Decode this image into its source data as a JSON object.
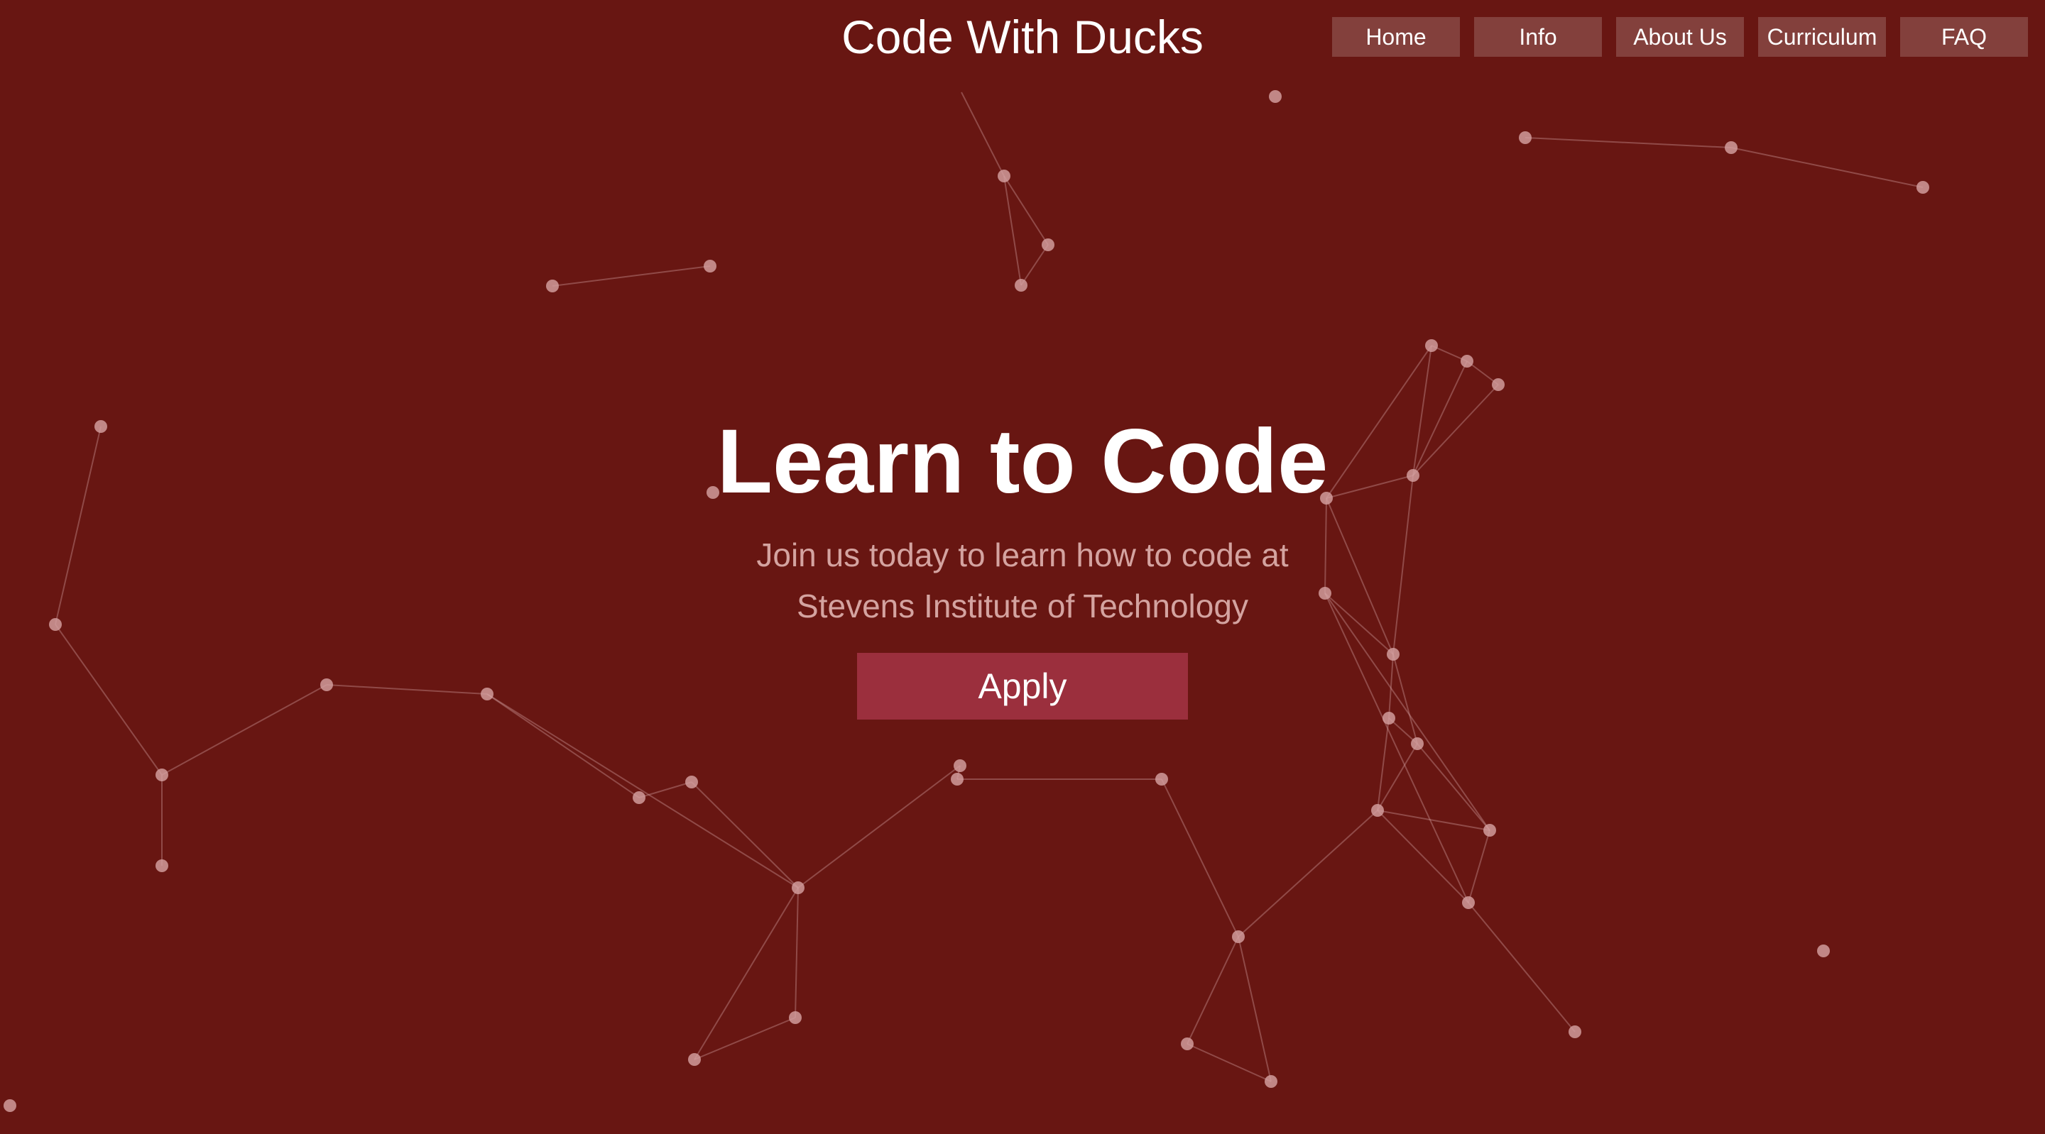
{
  "header": {
    "title": "Code With Ducks"
  },
  "nav": {
    "items": [
      {
        "label": "Home"
      },
      {
        "label": "Info"
      },
      {
        "label": "About Us"
      },
      {
        "label": "Curriculum"
      },
      {
        "label": "FAQ"
      }
    ]
  },
  "hero": {
    "title": "Learn to Code",
    "subtitle_line1": "Join us today to learn how to code at",
    "subtitle_line2": "Stevens Institute of Technology",
    "apply_label": "Apply"
  },
  "colors": {
    "background": "#681612",
    "nav_item_bg": "rgba(255,255,255,0.18)",
    "apply_button": "#9b2f3d",
    "subtitle_text": "#d4a3a0",
    "particle": "#d4a0a0"
  }
}
